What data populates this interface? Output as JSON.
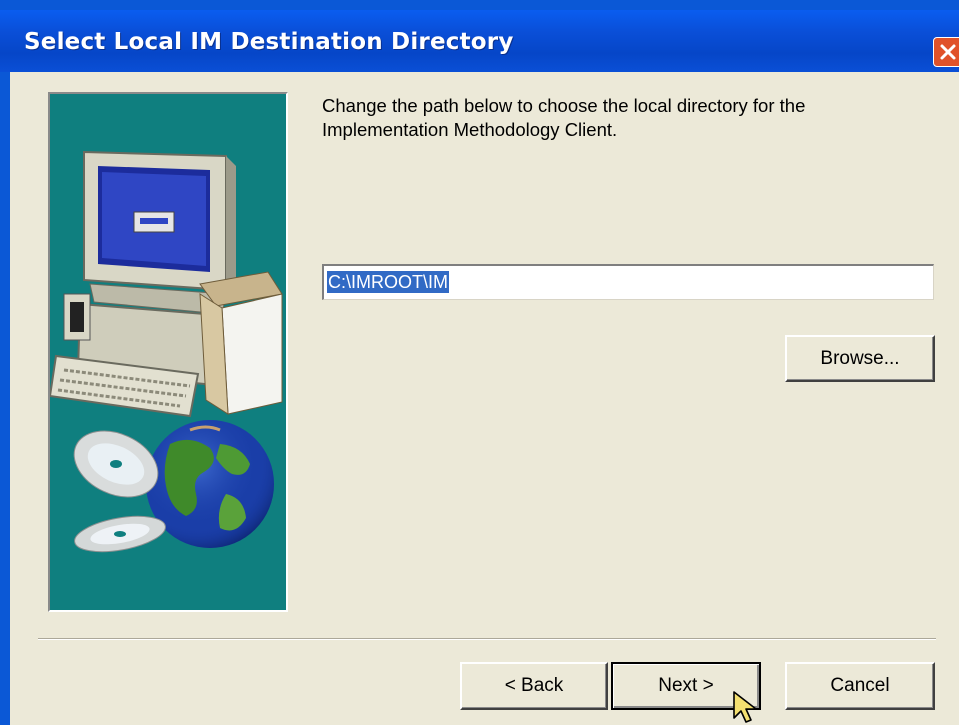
{
  "window": {
    "title": "Select Local IM Destination Directory"
  },
  "content": {
    "description": "Change the path below to choose the local directory for the Implementation Methodology Client.",
    "path_value": "C:\\IMROOT\\IM",
    "browse_label": "Browse..."
  },
  "footer": {
    "back_label": "< Back",
    "next_label": "Next >",
    "cancel_label": "Cancel"
  },
  "icons": {
    "close": "close-icon",
    "illustration": "computer-globe-illustration",
    "cursor": "arrow-cursor-icon"
  },
  "colors": {
    "titlebar": "#0a4fd8",
    "dialog_bg": "#ece9d8",
    "panel_teal": "#0f7f7f",
    "selection": "#316ac5",
    "close_button": "#e0522a"
  }
}
